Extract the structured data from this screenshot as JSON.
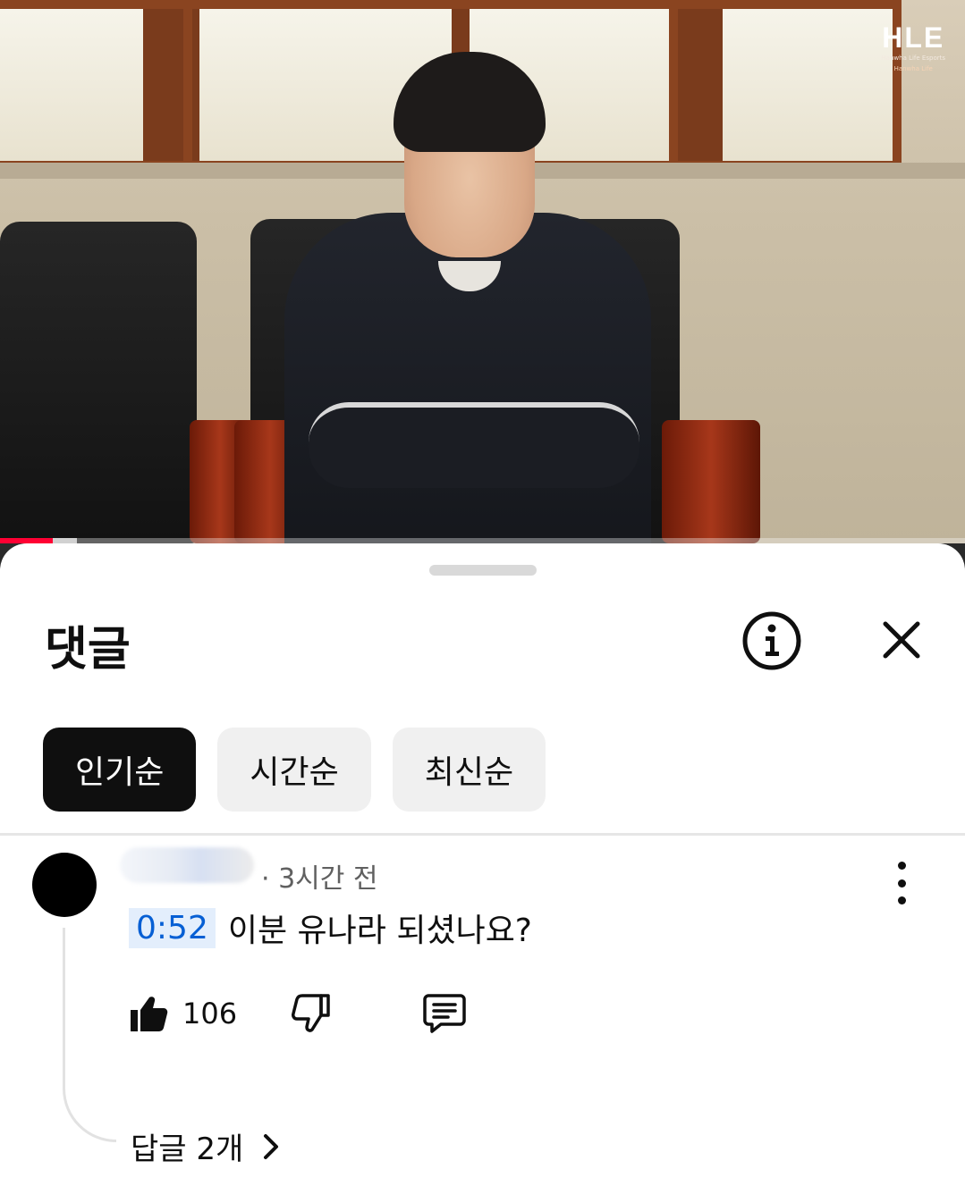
{
  "video": {
    "brand": {
      "logo_text": "HLE",
      "line1": "Hanwha Life Esports",
      "line2": "Hanwha Life"
    },
    "progress": {
      "played_fraction": 0.055,
      "buffered_fraction": 0.08
    },
    "colors": {
      "progress": "#ff0033"
    }
  },
  "sheet": {
    "title": "댓글",
    "info_icon": "info-circle-icon",
    "close_icon": "close-icon",
    "sort_chips": [
      {
        "label": "인기순",
        "active": true
      },
      {
        "label": "시간순",
        "active": false
      },
      {
        "label": "최신순",
        "active": false
      }
    ]
  },
  "comment": {
    "meta": "· 3시간 전",
    "timestamp": "0:52",
    "text": "이분 유나라 되셨나요?",
    "likes": "106",
    "replies_label": "답글 2개",
    "colors": {
      "timestamp_text": "#065fd4",
      "timestamp_bg": "#e3eefc"
    }
  }
}
